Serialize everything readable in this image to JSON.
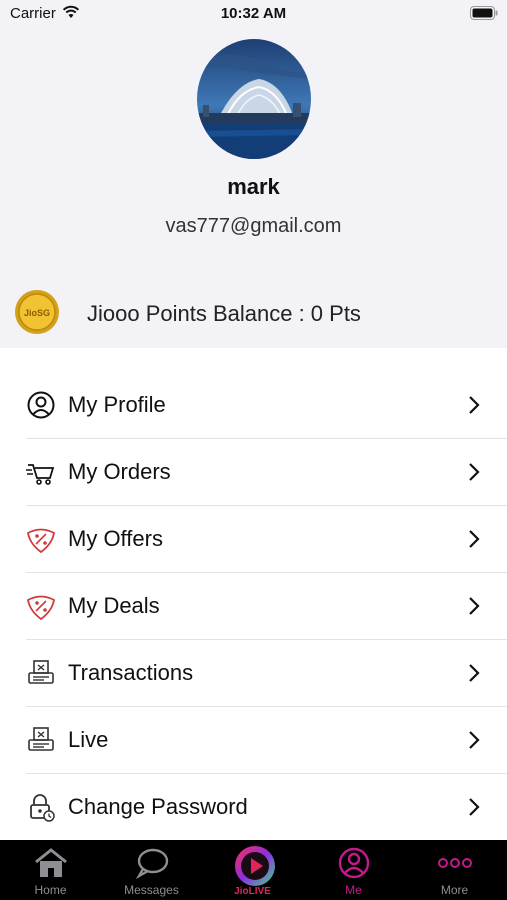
{
  "status_bar": {
    "carrier": "Carrier",
    "time": "10:32 AM"
  },
  "profile": {
    "name": "mark",
    "email": "vas777@gmail.com",
    "coin_text": "JioSG",
    "points_label": "Jiooo Points Balance : 0 Pts"
  },
  "menu": [
    {
      "label": "My Profile",
      "icon": "person-circle-icon"
    },
    {
      "label": "My Orders",
      "icon": "cart-icon"
    },
    {
      "label": "My Offers",
      "icon": "offer-tag-icon"
    },
    {
      "label": "My Deals",
      "icon": "deal-tag-icon"
    },
    {
      "label": "Transactions",
      "icon": "receipt-icon"
    },
    {
      "label": "Live",
      "icon": "live-receipt-icon"
    },
    {
      "label": "Change Password",
      "icon": "lock-icon"
    }
  ],
  "tabs": [
    {
      "label": "Home",
      "icon": "home-icon"
    },
    {
      "label": "Messages",
      "icon": "chat-bubble-icon"
    },
    {
      "label": "JioLIVE",
      "icon": "jiolive-logo-icon"
    },
    {
      "label": "Me",
      "icon": "person-icon"
    },
    {
      "label": "More",
      "icon": "ellipsis-icon"
    }
  ],
  "colors": {
    "accent": "#c21a8c",
    "header_bg": "#f2f2f7",
    "tab_bar_bg": "#000000",
    "icon_red": "#d23a3a"
  }
}
